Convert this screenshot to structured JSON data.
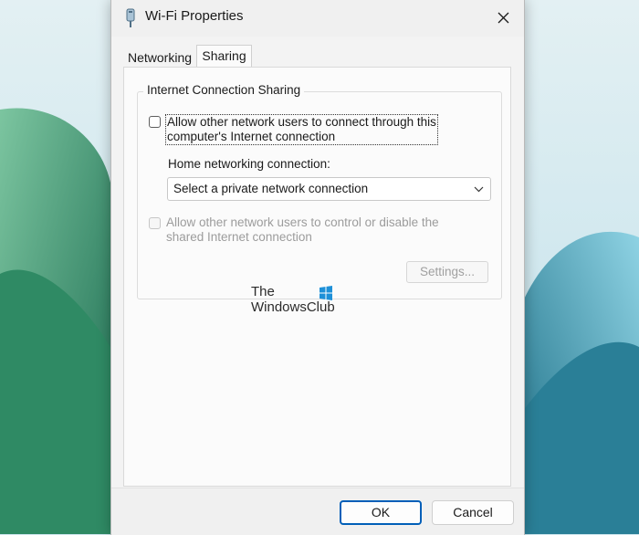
{
  "window": {
    "title": "Wi-Fi Properties",
    "icon": "wifi-adapter-icon",
    "close_icon": "close-icon"
  },
  "tabs": [
    {
      "label": "Networking",
      "selected": false
    },
    {
      "label": "Sharing",
      "selected": true
    }
  ],
  "sharing": {
    "group_title": "Internet Connection Sharing",
    "allow_connect": {
      "label_line1": "Allow other network users to connect through this",
      "label_line2": "computer's Internet connection",
      "checked": false
    },
    "home_networking_label": "Home networking connection:",
    "home_networking_select": {
      "value": "Select a private network connection"
    },
    "allow_control": {
      "label_line1": "Allow other network users to control or disable the",
      "label_line2": "shared Internet connection",
      "checked": false,
      "enabled": false
    },
    "settings_button": "Settings..."
  },
  "watermark": {
    "line1": "The",
    "line2": "WindowsClub"
  },
  "footer": {
    "ok_label": "OK",
    "cancel_label": "Cancel"
  },
  "colors": {
    "accent": "#005fb8",
    "wallpaper_green": "#3f9a6e",
    "wallpaper_teal": "#2c8aa0"
  }
}
